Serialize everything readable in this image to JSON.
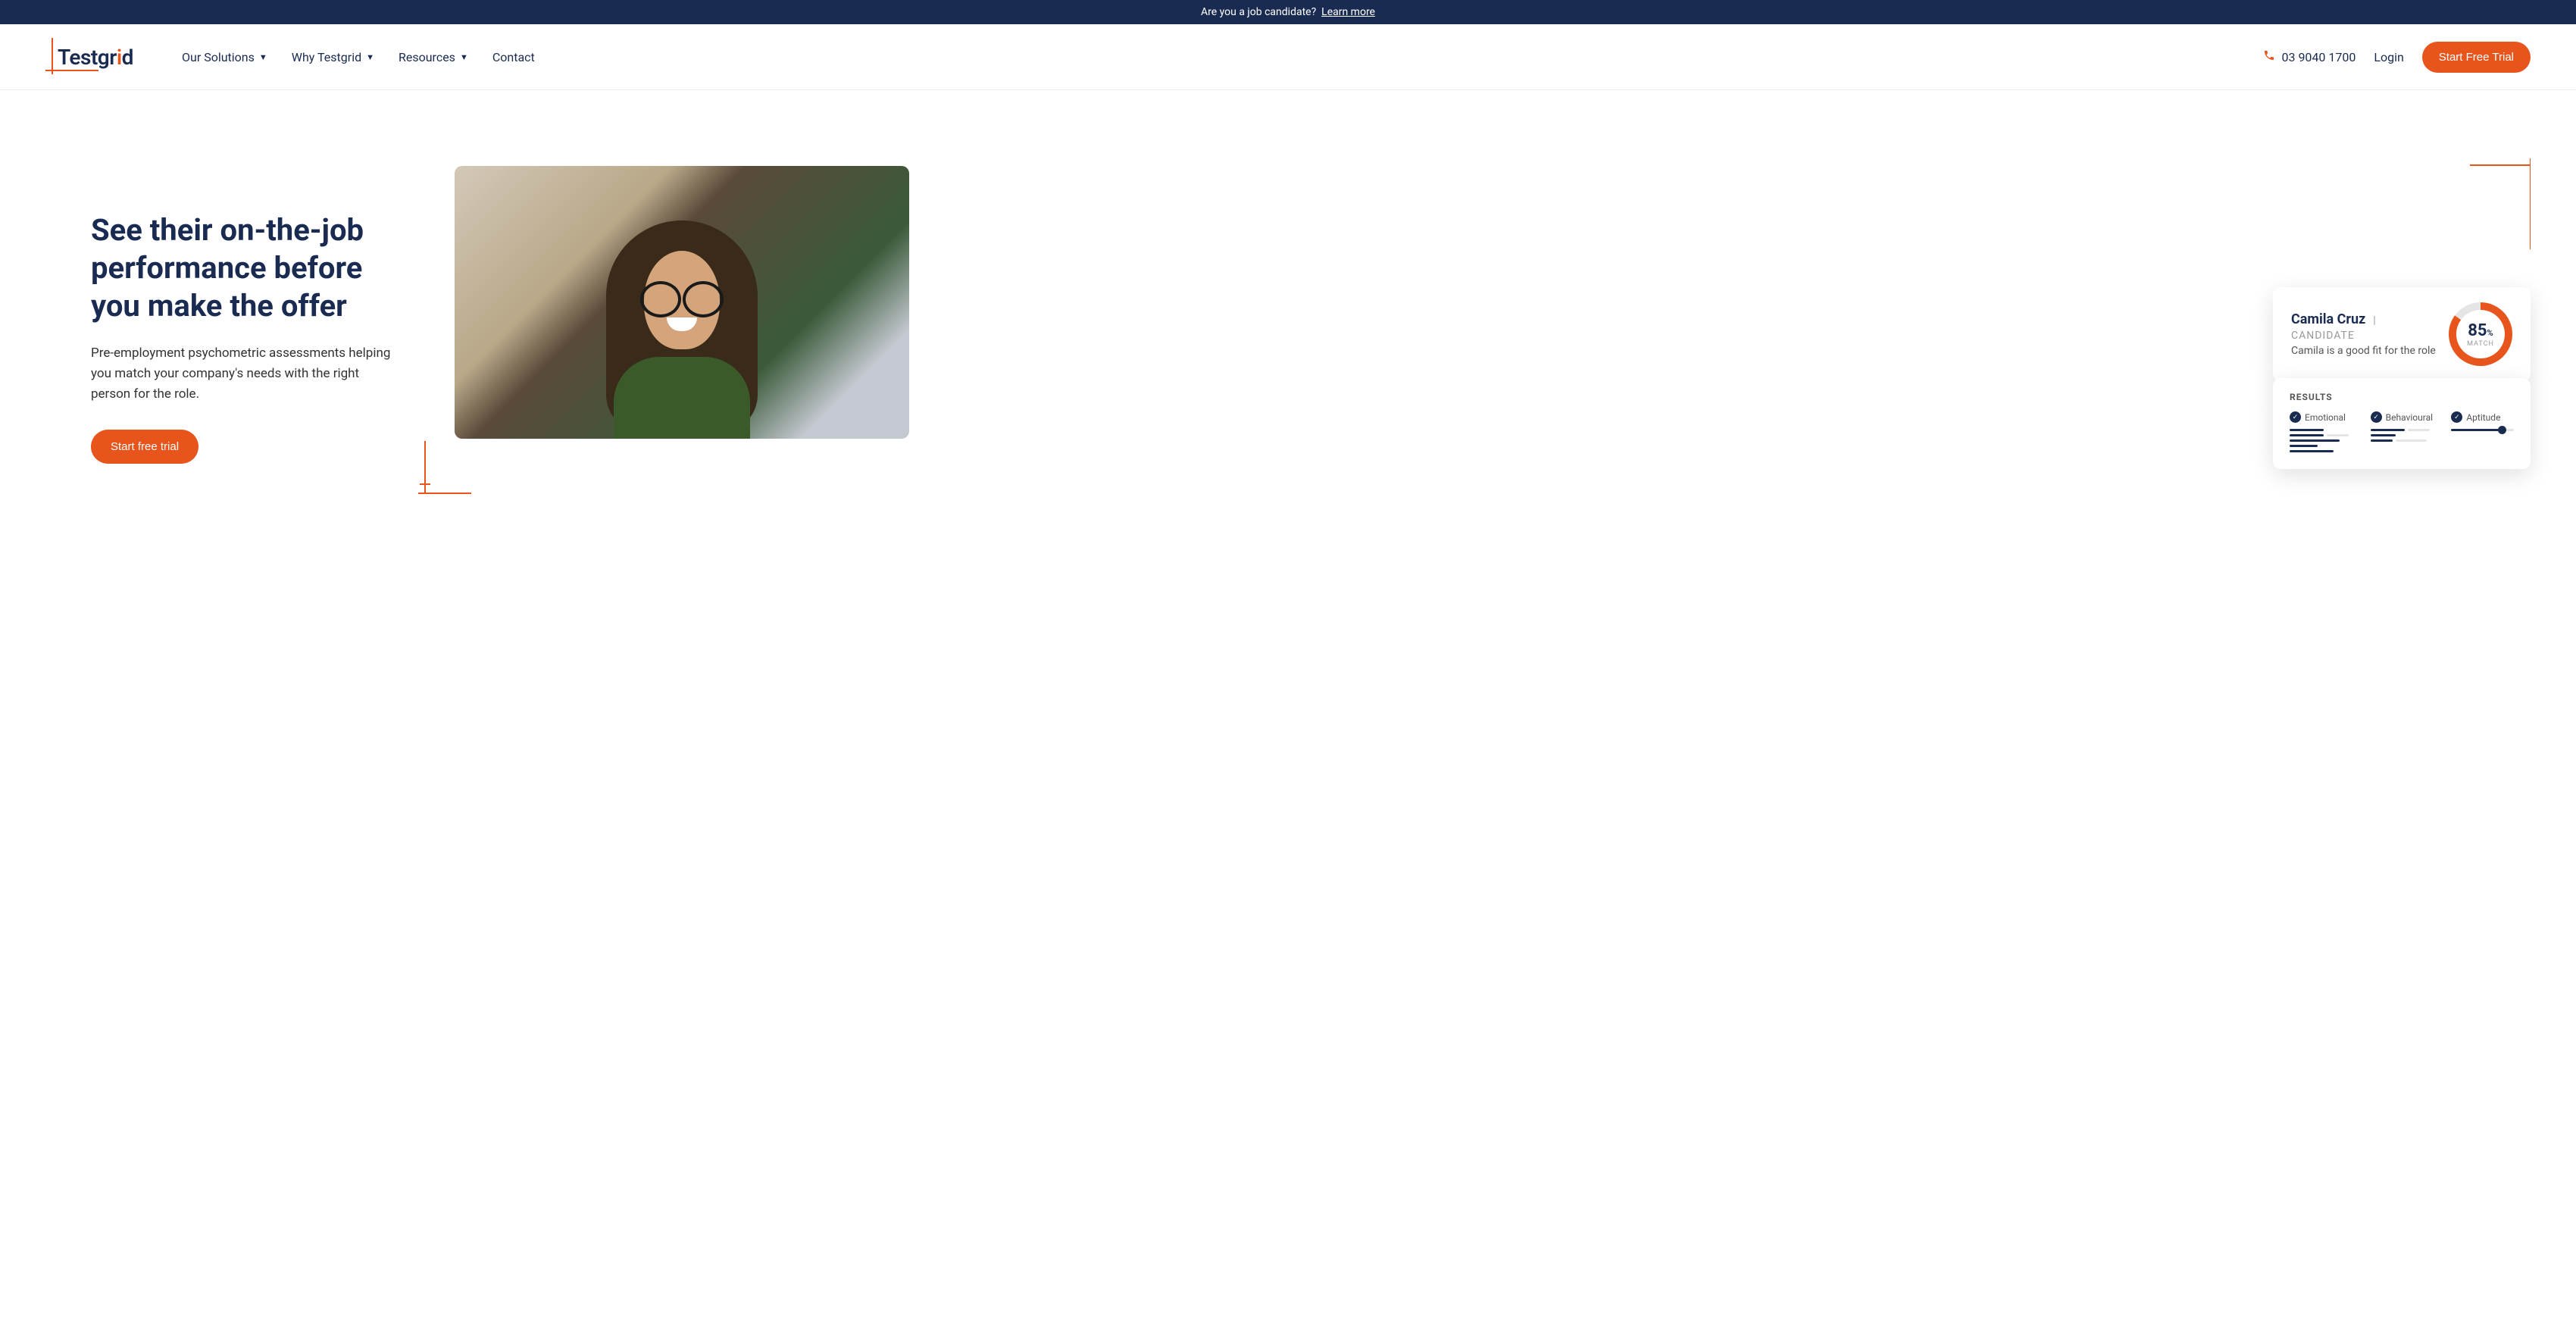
{
  "banner": {
    "text": "Are you a job candidate?",
    "link": "Learn more"
  },
  "logo": {
    "text_1": "Testgr",
    "dot": "i",
    "text_2": "d"
  },
  "nav": {
    "solutions": "Our Solutions",
    "why": "Why Testgrid",
    "resources": "Resources",
    "contact": "Contact"
  },
  "header": {
    "phone": "03 9040 1700",
    "login": "Login",
    "cta": "Start Free Trial"
  },
  "hero": {
    "title": "See their on-the-job performance before you make the offer",
    "sub": "Pre-employment psychometric assessments helping you match your company's needs with the right person for the role.",
    "cta": "Start free trial"
  },
  "candidate": {
    "name": "Camila Cruz",
    "tag": "| CANDIDATE",
    "fit": "Camila is a good fit for the role",
    "match_pct": "85",
    "match_pct_sym": "%",
    "match_label": "MATCH"
  },
  "results": {
    "title": "RESULTS",
    "emotional": "Emotional",
    "behavioural": "Behavioural",
    "aptitude": "Aptitude"
  }
}
